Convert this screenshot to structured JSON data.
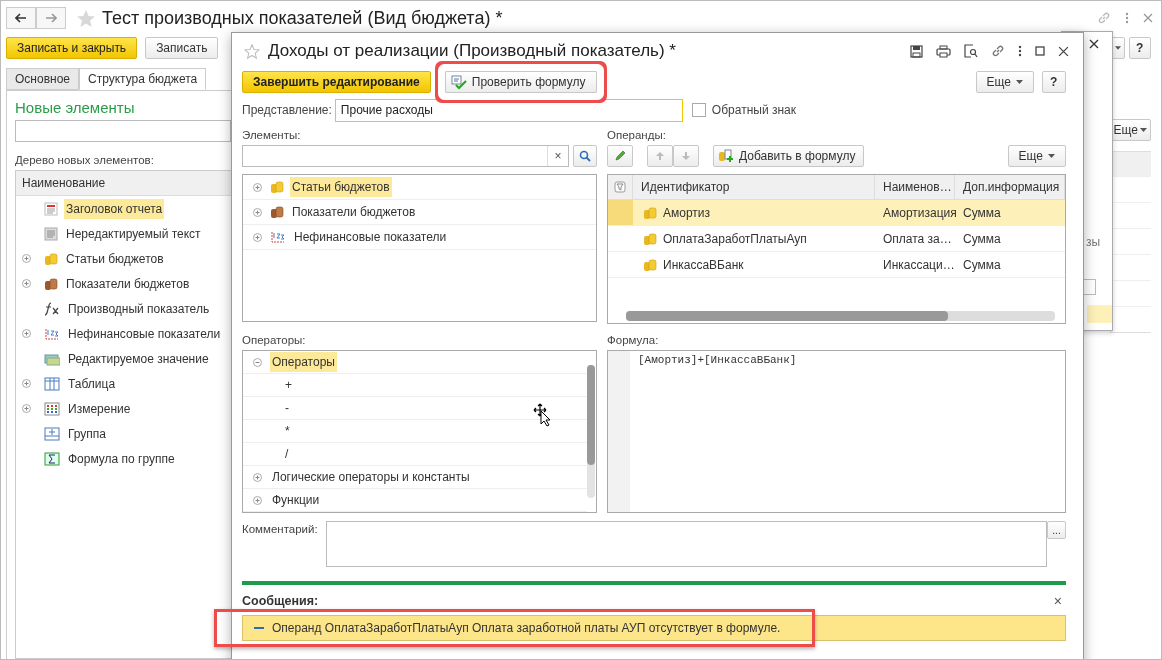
{
  "main_window": {
    "title": "Тест производных показателей (Вид бюджета) *",
    "buttons": [
      {
        "label": "Записать и закрыть",
        "kind": "primary"
      },
      {
        "label": "Записать",
        "kind": "default"
      }
    ],
    "tabs": [
      {
        "label": "Основное",
        "selected": false
      },
      {
        "label": "Структура бюджета",
        "selected": true
      }
    ],
    "section_title": "Новые элементы",
    "tree_caption": "Дерево новых элементов:",
    "tree_column": "Наименование",
    "tree_items": [
      {
        "label": "Заголовок отчета",
        "kind": "report-header",
        "expandable": false,
        "selected": true
      },
      {
        "label": "Нередактируемый текст",
        "kind": "plain-text",
        "expandable": false,
        "selected": false
      },
      {
        "label": "Статьи бюджетов",
        "kind": "coins",
        "expandable": true,
        "selected": false
      },
      {
        "label": "Показатели бюджетов",
        "kind": "brown-coins",
        "expandable": true,
        "selected": false
      },
      {
        "label": "Производный показатель",
        "kind": "function",
        "expandable": false,
        "selected": false
      },
      {
        "label": "Нефинансовые показатели",
        "kind": "numbers",
        "expandable": true,
        "selected": false
      },
      {
        "label": "Редактируемое значение",
        "kind": "editable",
        "expandable": false,
        "selected": false
      },
      {
        "label": "Таблица",
        "kind": "table",
        "expandable": true,
        "selected": false
      },
      {
        "label": "Измерение",
        "kind": "dimension",
        "expandable": true,
        "selected": false
      },
      {
        "label": "Группа",
        "kind": "group",
        "expandable": false,
        "selected": false
      },
      {
        "label": "Формула по группе",
        "kind": "group-formula",
        "expandable": false,
        "selected": false
      }
    ],
    "help_button": "?",
    "more_button": "Еще"
  },
  "back_window": {
    "text_fragment": "зы",
    "highlighted_row": true
  },
  "dialog": {
    "title": "Доходы от реализации (Производный показатель) *",
    "finish_button": "Завершить редактирование",
    "check_button": {
      "label": "Проверить формулу",
      "highlighted": true
    },
    "more_button": "Еще",
    "help_button": "?",
    "presentation": {
      "label": "Представление:",
      "value": "Прочие расходы"
    },
    "reverse_sign": {
      "label": "Обратный знак",
      "checked": false
    },
    "elements": {
      "label": "Элементы:",
      "clear": "×",
      "items": [
        {
          "label": "Статьи бюджетов",
          "kind": "coins",
          "selected": true
        },
        {
          "label": "Показатели бюджетов",
          "kind": "brown-coins",
          "selected": false
        },
        {
          "label": "Нефинансовые показатели",
          "kind": "numbers",
          "selected": false
        }
      ]
    },
    "operands": {
      "label": "Операнды:",
      "add_button": "Добавить в формулу",
      "more_button": "Еще",
      "columns": [
        "Идентификатор",
        "Наименов…",
        "Доп.информация"
      ],
      "rows": [
        {
          "id": "Амортиз",
          "name": "Амортизация",
          "info": "Сумма",
          "selected": true
        },
        {
          "id": "ОплатаЗаработПлатыАуп",
          "name": "Оплата за…",
          "info": "Сумма",
          "selected": false
        },
        {
          "id": "ИнкассаВБанк",
          "name": "Инкассаци…",
          "info": "Сумма",
          "selected": false
        }
      ]
    },
    "operators": {
      "label": "Операторы:",
      "items": [
        {
          "label": "Операторы",
          "expanded": true,
          "selected": true,
          "children": [
            {
              "label": "+"
            },
            {
              "label": "-"
            },
            {
              "label": "*"
            },
            {
              "label": "/"
            }
          ]
        },
        {
          "label": "Логические операторы и константы",
          "expanded": false,
          "selected": false
        },
        {
          "label": "Функции",
          "expanded": false,
          "selected": false
        }
      ]
    },
    "formula": {
      "label": "Формула:",
      "text": "[Амортиз]+[ИнкассаВБанк]"
    },
    "comment": {
      "label": "Комментарий:",
      "button": "..."
    },
    "messages": {
      "title": "Сообщения:",
      "close": "×",
      "items": [
        {
          "text": "Операнд ОплатаЗаработПлатыАуп Оплата заработной платы АУП отсутствует в формуле.",
          "highlighted": true
        }
      ]
    }
  }
}
